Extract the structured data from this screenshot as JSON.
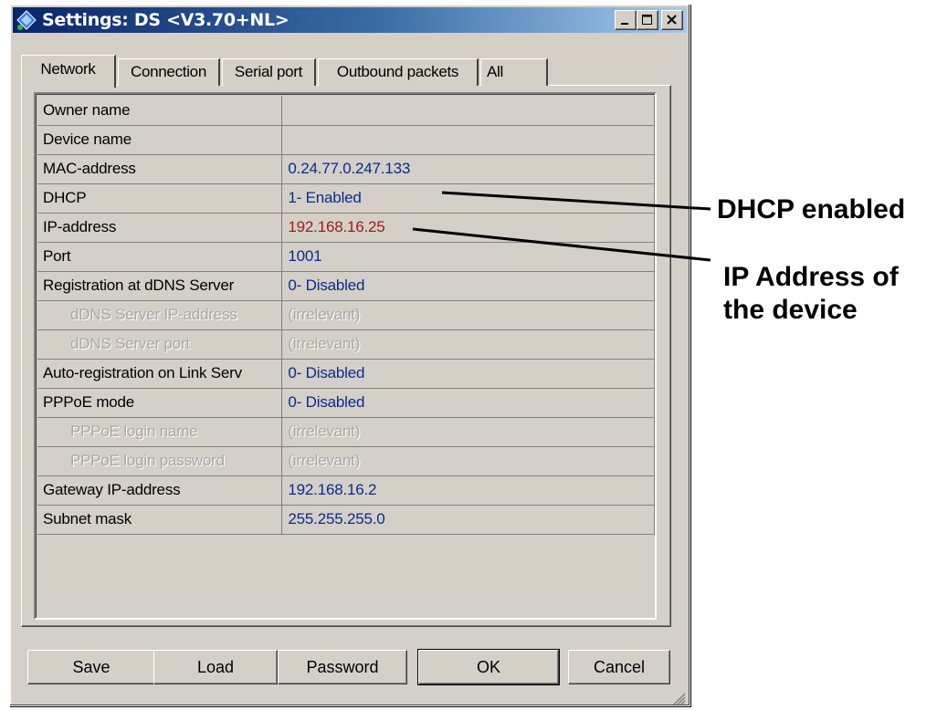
{
  "window": {
    "title": "Settings: DS <V3.70+NL>",
    "controls": {
      "minimize": "minimize-icon",
      "maximize": "maximize-icon",
      "close": "close-icon"
    }
  },
  "tabs": [
    {
      "label": "Network",
      "active": true
    },
    {
      "label": "Connection",
      "active": false
    },
    {
      "label": "Serial port",
      "active": false
    },
    {
      "label": "Outbound packets",
      "active": false
    },
    {
      "label": "All",
      "active": false
    }
  ],
  "settings": [
    {
      "name": "Owner name",
      "value": ""
    },
    {
      "name": "Device name",
      "value": ""
    },
    {
      "name": "MAC-address",
      "value": "0.24.77.0.247.133"
    },
    {
      "name": "DHCP",
      "value": "1- Enabled"
    },
    {
      "name": "IP-address",
      "value": "192.168.16.25"
    },
    {
      "name": "Port",
      "value": "1001"
    },
    {
      "name": "Registration at dDNS Server",
      "value": "0- Disabled"
    },
    {
      "name": "dDNS Server IP-address",
      "value": "(irrelevant)"
    },
    {
      "name": "dDNS Server port",
      "value": "(irrelevant)"
    },
    {
      "name": "Auto-registration on Link Serv",
      "value": "0- Disabled"
    },
    {
      "name": "PPPoE mode",
      "value": "0- Disabled"
    },
    {
      "name": "PPPoE login name",
      "value": "(irrelevant)"
    },
    {
      "name": "PPPoE login password",
      "value": "(irrelevant)"
    },
    {
      "name": "Gateway IP-address",
      "value": "192.168.16.2"
    },
    {
      "name": "Subnet mask",
      "value": "255.255.255.0"
    }
  ],
  "buttons": {
    "save": "Save",
    "load": "Load",
    "password": "Password",
    "ok": "OK",
    "cancel": "Cancel"
  },
  "annotations": {
    "dhcp": "DHCP enabled",
    "ip_line1": "IP Address of",
    "ip_line2": "the device"
  },
  "colors": {
    "value_text": "#0b2b8c",
    "highlight_value": "#a01c1c",
    "disabled_text": "#a9a7a2",
    "titlebar_start": "#0a246a",
    "face": "#d4d0c8"
  }
}
